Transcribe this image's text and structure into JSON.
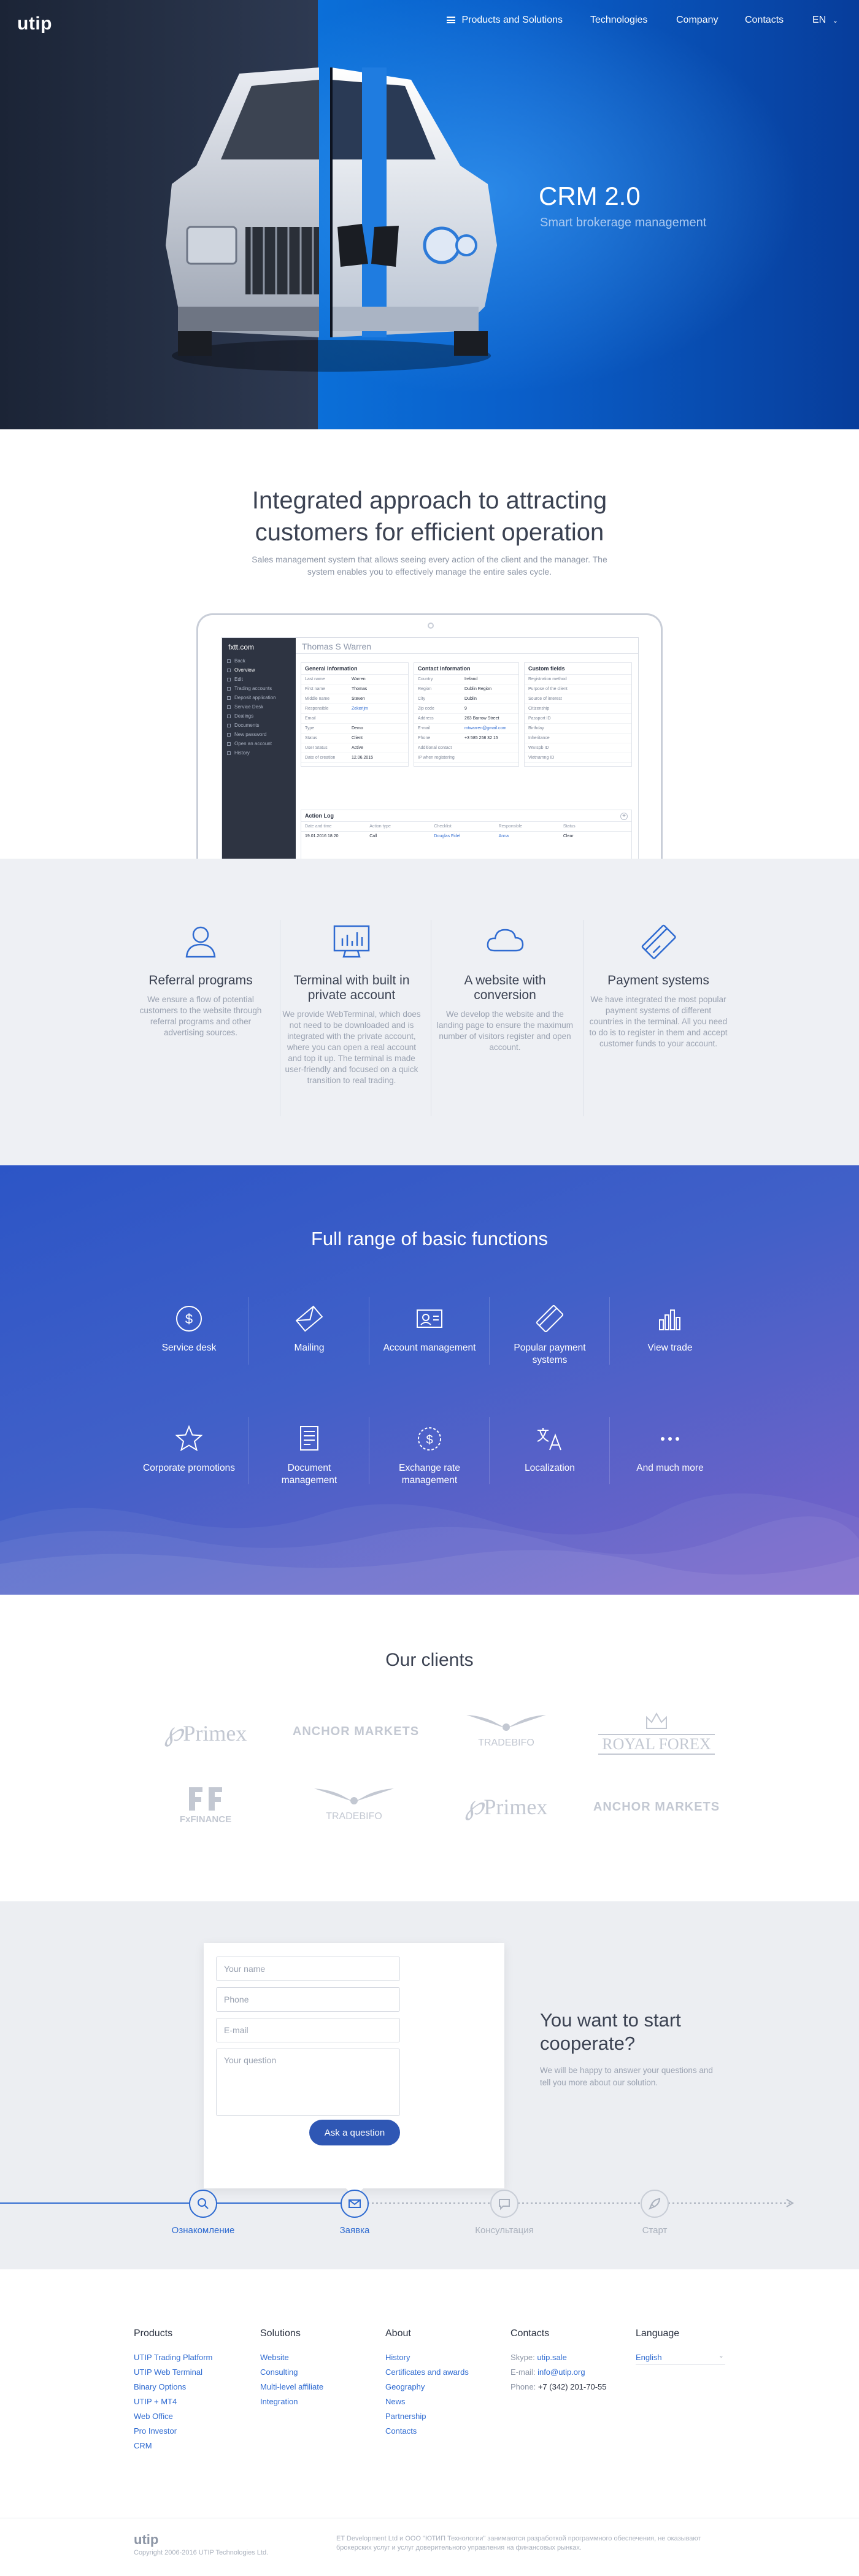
{
  "header": {
    "logo": "utip",
    "nav": [
      "Products and Solutions",
      "Technologies",
      "Company",
      "Contacts"
    ],
    "language": "EN"
  },
  "hero": {
    "title": "CRM 2.0",
    "subtitle": "Smart brokerage management"
  },
  "intro": {
    "title_line1": "Integrated approach to attracting",
    "title_line2": "customers for efficient operation",
    "desc": "Sales management system that allows seeing every action of the client and the manager. The system enables you to effectively manage the entire sales cycle."
  },
  "crm_mock": {
    "logo": "fxtt.com",
    "user": "Thomas S Warren",
    "sidebar": [
      "Back",
      "Overview",
      "Edit",
      "Trading accounts",
      "Deposit application",
      "Service Desk",
      "Dealings",
      "Documents",
      "New password",
      "Open an account",
      "History"
    ],
    "general_title": "General Information",
    "general": [
      [
        "Last name",
        "Warren"
      ],
      [
        "First name",
        "Thomas"
      ],
      [
        "Middle name",
        "Steven"
      ],
      [
        "Responsible",
        "Zekerijm"
      ],
      [
        "Email",
        ""
      ],
      [
        "Type",
        "Demo"
      ],
      [
        "Status",
        "Client"
      ],
      [
        "User Status",
        "Active"
      ],
      [
        "Date of creation",
        "12.06.2015"
      ]
    ],
    "contact_title": "Contact Information",
    "contact": [
      [
        "Country",
        "Ireland"
      ],
      [
        "Region",
        "Dublin Region"
      ],
      [
        "City",
        "Dublin"
      ],
      [
        "Zip code",
        "9"
      ],
      [
        "Address",
        "263 Barrow Street"
      ],
      [
        "E-mail",
        "mtwarren@gmail.com"
      ],
      [
        "Phone",
        "+3 585 258 32 15"
      ],
      [
        "Additional contact",
        ""
      ],
      [
        "IP when registering",
        ""
      ]
    ],
    "custom_title": "Custom fields",
    "custom": [
      "Registration method",
      "Purpose of the client",
      "Source of interest",
      "Citizenship",
      "Passport ID",
      "Birthday",
      "Inheritance",
      "WEIspb ID",
      "Vietnamng ID"
    ],
    "log_title": "Action Log",
    "log_headers": [
      "Date and time",
      "Action type",
      "Checklist",
      "Responsible",
      "Status"
    ],
    "log_rows": [
      [
        "19.01.2016 18:20",
        "Call",
        "Douglas Fidel",
        "Anna",
        "Clear"
      ]
    ]
  },
  "features": [
    {
      "icon": "user-icon",
      "title": "Referral programs",
      "text": "We ensure a flow of potential customers to the website through referral programs and other advertising sources."
    },
    {
      "icon": "terminal-icon",
      "title": "Terminal with built in private account",
      "text": "We provide WebTerminal, which does not need to be downloaded and is integrated with the private account, where you can open a real account and top it up. The terminal is made user-friendly and focused on a quick transition to real trading."
    },
    {
      "icon": "cloud-icon",
      "title": "A website with conversion",
      "text": "We develop the website and the landing page to ensure the maximum number of visitors register and open account."
    },
    {
      "icon": "card-icon",
      "title": "Payment systems",
      "text": "We have integrated the most popular payment systems of different countries in the terminal. All you need to do is to register in them and accept customer funds to your account."
    }
  ],
  "functions": {
    "title": "Full range of basic functions",
    "items": [
      {
        "icon": "dollar-circle-icon",
        "label": "Service desk"
      },
      {
        "icon": "envelope-icon",
        "label": "Mailing"
      },
      {
        "icon": "account-icon",
        "label": "Account management"
      },
      {
        "icon": "payment-icon",
        "label": "Popular payment systems"
      },
      {
        "icon": "bar-chart-icon",
        "label": "View trade"
      },
      {
        "icon": "star-icon",
        "label": "Corporate promotions"
      },
      {
        "icon": "document-icon",
        "label": "Document management"
      },
      {
        "icon": "exchange-rate-icon",
        "label": "Exchange rate management"
      },
      {
        "icon": "translate-icon",
        "label": "Localization"
      },
      {
        "icon": "dots-icon",
        "label": "And much more"
      }
    ]
  },
  "clients": {
    "title": "Our clients",
    "logos": [
      "Primex",
      "ANCHOR MARKETS",
      "TRADEBIFO",
      "ROYAL FOREX",
      "FxFINANCE",
      "TRADEBIFO",
      "Primex",
      "ANCHOR MARKETS"
    ]
  },
  "contact": {
    "name_ph": "Your name",
    "phone_ph": "Phone",
    "email_ph": "E-mail",
    "question_ph": "Your question",
    "button": "Ask a question",
    "title_line1": "You want to start",
    "title_line2": "cooperate?",
    "text": "We will be happy to answer your questions and tell you more about our solution.",
    "steps": [
      {
        "label": "Ознакомление",
        "icon": "search-icon",
        "done": true
      },
      {
        "label": "Заявка",
        "icon": "mail-icon",
        "done": true
      },
      {
        "label": "Консультация",
        "icon": "chat-icon",
        "done": false
      },
      {
        "label": "Старт",
        "icon": "rocket-icon",
        "done": false
      }
    ]
  },
  "footer": {
    "products_title": "Products",
    "products": [
      "UTIP Trading Platform",
      "UTIP Web Terminal",
      "Binary Options",
      "UTIP + MT4",
      "Web Office",
      "Pro Investor",
      "CRM"
    ],
    "solutions_title": "Solutions",
    "solutions": [
      "Website",
      "Consulting",
      "Multi-level affiliate",
      "Integration"
    ],
    "about_title": "About",
    "about": [
      "History",
      "Certificates and awards",
      "Geography",
      "News",
      "Partnership",
      "Contacts"
    ],
    "contacts_title": "Contacts",
    "skype_label": "Skype:",
    "skype": "utip.sale",
    "email_label": "E-mail:",
    "email": "info@utip.org",
    "phone_label": "Phone:",
    "phone": "+7 (342) 201-70-55",
    "language_title": "Language",
    "language": "English",
    "bottom_logo": "utip",
    "copyright": "Copyright 2006-2016 UTIP Technologies Ltd.",
    "legal": "ET Development Ltd и ООО \"ЮТИП Технологии\" занимаются разработкой программного обеспечения, не оказывают брокерских услуг и услуг доверительного управления на финансовых рынках."
  },
  "colors": {
    "accent": "#2f57b4",
    "link": "#2f6bd1",
    "hero_blue": "#0b6fd8",
    "functions_start": "#2c55c6",
    "functions_end": "#7a63c9"
  }
}
